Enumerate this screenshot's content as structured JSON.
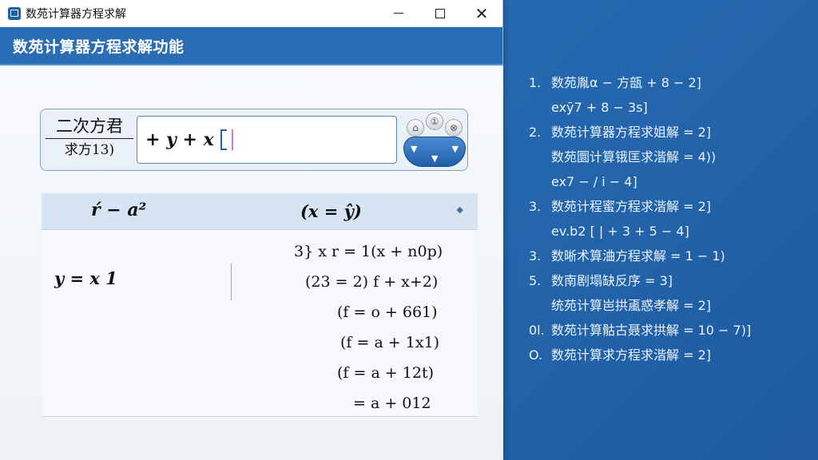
{
  "window": {
    "title": "数苑计算器方程求解",
    "header": "数苑计算器方程求解功能",
    "controls": {
      "minimize": "",
      "maximize": "",
      "close": "✕"
    }
  },
  "input_card": {
    "type_top": "二次方君",
    "type_bottom": "求方13)",
    "expression": "+ y + x",
    "keys": [
      "⌂",
      "①",
      "⊗"
    ],
    "nav_arrows": [
      "▼",
      "▼",
      "▼"
    ]
  },
  "result": {
    "header_left": "ŕ − a²",
    "header_mid": "(x = ŷ)",
    "header_dot": "◆",
    "lhs": "y = x 1",
    "steps": [
      "3} x r = 1(x + n0p)",
      "(23 = 2) f + x+2)",
      "(f = o + 661)",
      "(f = a + 1x1)",
      "(f = a + 12t)",
      "= a + 012"
    ]
  },
  "side_list": [
    {
      "num": "1.",
      "text": "数苑胤α − 方瓿 + 8 − 2]"
    },
    {
      "num": "",
      "text": "exȳ7 + 8 − 3s]"
    },
    {
      "num": "2.",
      "text": "数苑计算器方程求姐解 = 2]"
    },
    {
      "num": "",
      "text": "数苑圜计算锇匡求湝解 = 4))"
    },
    {
      "num": "",
      "text": "ex7 − / i − 4]"
    },
    {
      "num": "3.",
      "text": "数苑计程蜜方程求湝解 = 2]"
    },
    {
      "num": "",
      "text": "ev.b2 [ | + 3 + 5 − 4]"
    },
    {
      "num": "3.",
      "text": "数晰术算浀方程求解 = 1 − 1)"
    },
    {
      "num": "5.",
      "text": "数南剧塌缺反序 = 3]"
    },
    {
      "num": "",
      "text": "统苑计算岜拱颪惑孝解 = 2]"
    },
    {
      "num": "0l.",
      "text": "数苑计算骷古聂求拱解 = 10 − 7)]"
    },
    {
      "num": "O.",
      "text": "数苑计算求方程求湝解 = 2]"
    }
  ]
}
